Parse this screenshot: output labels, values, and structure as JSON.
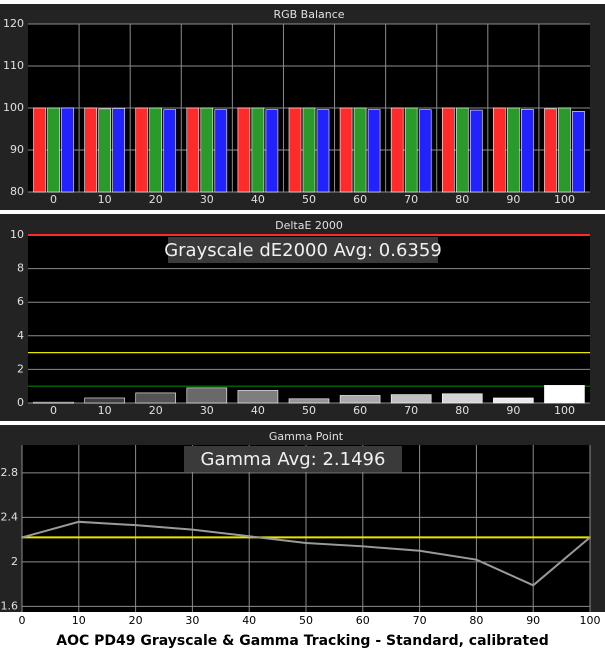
{
  "caption": "AOC PD49 Grayscale & Gamma Tracking - Standard, calibrated",
  "colors": {
    "panel_bg": "#232323",
    "plot_bg": "#000000",
    "grid": "#8c8c8c",
    "label": "#e0e0e0",
    "red": "#ff2a2a",
    "green": "#2a9a2a",
    "blue": "#2222ff",
    "yellow": "#e6e600",
    "dark_green": "#0a7a0a",
    "gamma_line": "#9a9a9a"
  },
  "chart_data": [
    {
      "type": "bar",
      "title": "RGB Balance",
      "categories": [
        "0",
        "10",
        "20",
        "30",
        "40",
        "50",
        "60",
        "70",
        "80",
        "90",
        "100"
      ],
      "ylim": [
        80,
        120
      ],
      "yticks": [
        80,
        90,
        100,
        110,
        120
      ],
      "series": [
        {
          "color": "red",
          "values": [
            100,
            100,
            100,
            100,
            100,
            100,
            100,
            100,
            100,
            100,
            99.8
          ]
        },
        {
          "color": "green",
          "values": [
            100,
            99.8,
            100,
            100,
            100,
            100,
            100,
            100,
            100,
            100,
            100
          ]
        },
        {
          "color": "blue",
          "values": [
            100,
            99.9,
            99.6,
            99.6,
            99.6,
            99.6,
            99.6,
            99.6,
            99.5,
            99.7,
            99.2
          ]
        }
      ]
    },
    {
      "type": "bar",
      "title": "DeltaE 2000",
      "annotation": "Grayscale dE2000 Avg: 0.6359",
      "categories": [
        "0",
        "10",
        "20",
        "30",
        "40",
        "50",
        "60",
        "70",
        "80",
        "90",
        "100"
      ],
      "ylim": [
        0,
        10
      ],
      "yticks": [
        0,
        2,
        4,
        6,
        8,
        10
      ],
      "values": [
        0.05,
        0.3,
        0.6,
        0.9,
        0.75,
        0.25,
        0.45,
        0.5,
        0.55,
        0.3,
        1.05
      ],
      "reference_lines": [
        {
          "value": 10,
          "color": "red"
        },
        {
          "value": 3,
          "color": "yellow"
        },
        {
          "value": 1,
          "color": "dark_green"
        }
      ]
    },
    {
      "type": "line",
      "title": "Gamma Point",
      "annotation": "Gamma Avg: 2.1496",
      "x": [
        0,
        10,
        20,
        30,
        40,
        50,
        60,
        70,
        80,
        90,
        100
      ],
      "y": [
        2.22,
        2.36,
        2.33,
        2.29,
        2.23,
        2.17,
        2.14,
        2.1,
        2.02,
        1.79,
        2.22
      ],
      "xlim": [
        0,
        100
      ],
      "ylim": [
        1.55,
        3.05
      ],
      "xticks": [
        0,
        10,
        20,
        30,
        40,
        50,
        60,
        70,
        80,
        90,
        100
      ],
      "yticks": [
        1.6,
        2,
        2.4,
        2.8
      ],
      "ytick_labels": [
        "1.6",
        "2",
        "2.4",
        "2.8"
      ],
      "reference_value": 2.22
    }
  ]
}
